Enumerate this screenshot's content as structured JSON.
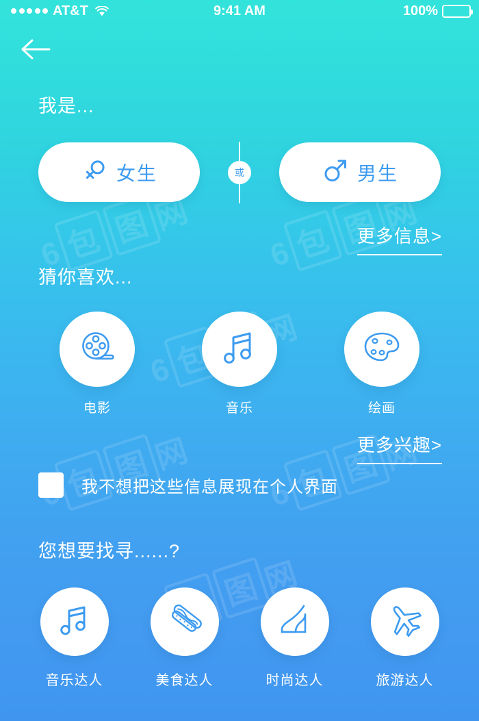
{
  "status_bar": {
    "carrier": "AT&T",
    "signal_dots": 5,
    "wifi_icon": "wifi-icon",
    "time": "9:41 AM",
    "battery_percent": "100%",
    "battery_icon": "battery-full-icon"
  },
  "nav": {
    "back_icon": "back-arrow-icon"
  },
  "sections": {
    "identity": {
      "heading": "我是...",
      "options": [
        {
          "label": "女生",
          "icon": "female-symbol-icon"
        },
        {
          "label": "男生",
          "icon": "male-symbol-icon"
        }
      ],
      "divider_label": "或",
      "more_link": "更多信息>"
    },
    "interests": {
      "heading": "猜你喜欢...",
      "items": [
        {
          "label": "电影",
          "icon": "film-reel-icon"
        },
        {
          "label": "音乐",
          "icon": "music-note-icon"
        },
        {
          "label": "绘画",
          "icon": "paint-palette-icon"
        }
      ],
      "more_link": "更多兴趣>",
      "privacy_checkbox": {
        "label": "我不想把这些信息展现在个人界面",
        "checked": false
      }
    },
    "seeking": {
      "heading": "您想要找寻......?",
      "items": [
        {
          "label": "音乐达人",
          "icon": "music-note-icon"
        },
        {
          "label": "美食达人",
          "icon": "hotdog-icon"
        },
        {
          "label": "时尚达人",
          "icon": "high-heel-icon"
        },
        {
          "label": "旅游达人",
          "icon": "airplane-icon"
        }
      ]
    }
  },
  "watermarks": [
    "6 包 图 网",
    "6 包 图 网",
    "6 包 图 网",
    "6 包 图 网",
    "6 包 图 网",
    "6 包 图 网"
  ],
  "colors": {
    "gradient_top": "#32e3db",
    "gradient_bottom": "#4096ef",
    "accent_blue": "#3d9bf0",
    "surface_white": "#ffffff"
  }
}
